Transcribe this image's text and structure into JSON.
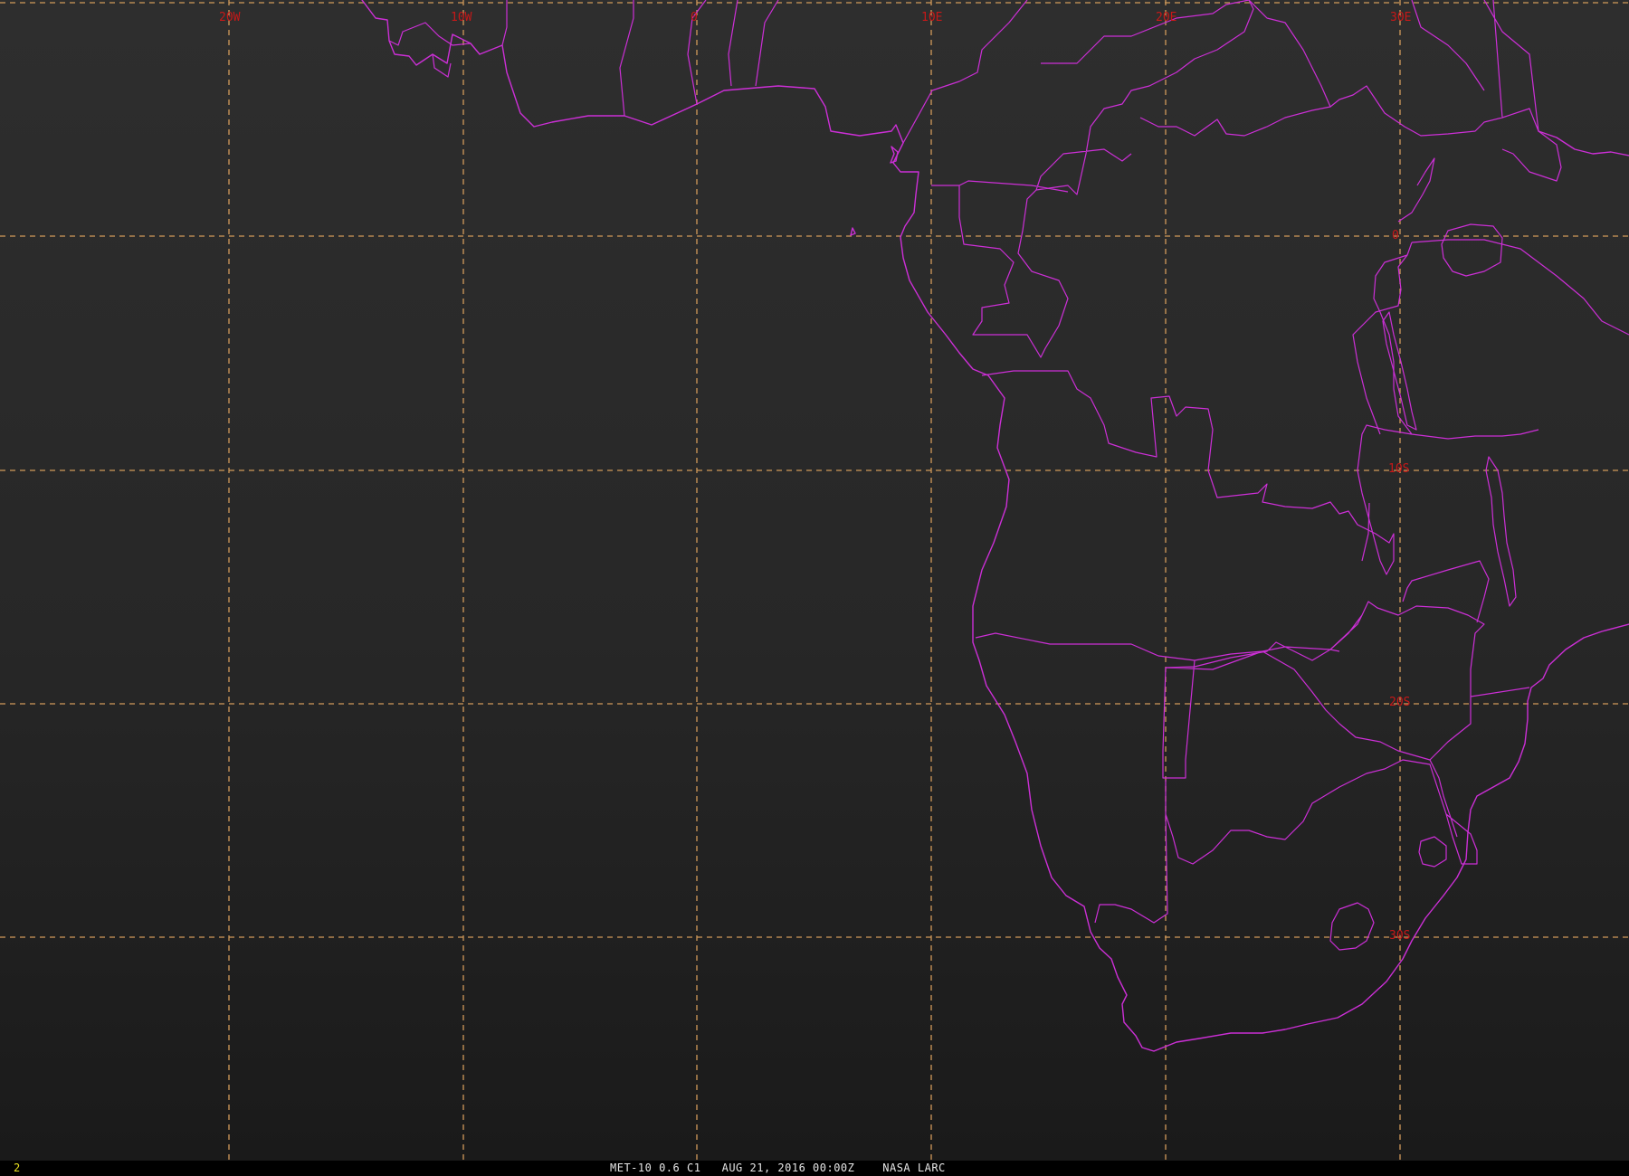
{
  "image": {
    "satellite_caption": "MET-10 0.6 C1   AUG 21, 2016 00:00Z    NASA LARC",
    "frame_number": "2"
  },
  "colors": {
    "background": "#1c1c1c",
    "gridlines": "#d29a5a",
    "grid_labels": "#c81818",
    "coastlines_borders": "#cc2fd6",
    "frame_number": "#e8e020"
  },
  "grid": {
    "longitude_labels": [
      "20W",
      "10W",
      "0",
      "10E",
      "20E",
      "30E"
    ],
    "latitude_labels": [
      "0",
      "10S",
      "20S",
      "30S"
    ]
  }
}
